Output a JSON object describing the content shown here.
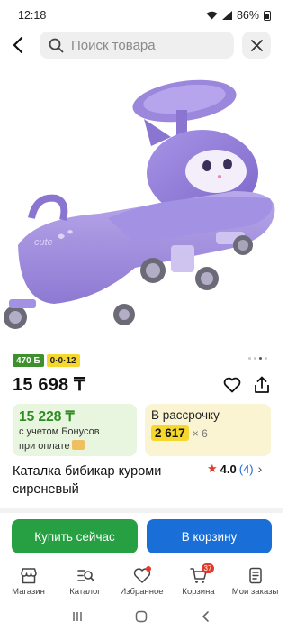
{
  "status": {
    "time": "12:18",
    "battery": "86%"
  },
  "search": {
    "placeholder": "Поиск товара"
  },
  "badges": {
    "points": "470",
    "points_symbol": "Б",
    "installment_code": "0·0·12"
  },
  "product": {
    "price": "15 698 ₸",
    "title": "Каталка бибикар куроми сиреневый",
    "rating": "4.0",
    "reviews": "(4)"
  },
  "bonus": {
    "price": "15 228 ₸",
    "line1": "с учетом Бонусов",
    "line2": "при оплате"
  },
  "installment": {
    "label": "В рассрочку",
    "amount": "2 617",
    "times": "× 6"
  },
  "actions": {
    "buy_now": "Купить сейчас",
    "to_cart": "В корзину"
  },
  "nav": {
    "items": [
      {
        "label": "Магазин",
        "icon": "shop-icon"
      },
      {
        "label": "Каталог",
        "icon": "catalog-icon"
      },
      {
        "label": "Избранное",
        "icon": "heart-icon"
      },
      {
        "label": "Корзина",
        "icon": "cart-icon"
      },
      {
        "label": "Мои заказы",
        "icon": "orders-icon"
      }
    ],
    "cart_count": "37"
  },
  "colors": {
    "green": "#27a043",
    "blue": "#1a6ed8",
    "accent_red": "#e03a2a",
    "yellow": "#f5d72e"
  }
}
